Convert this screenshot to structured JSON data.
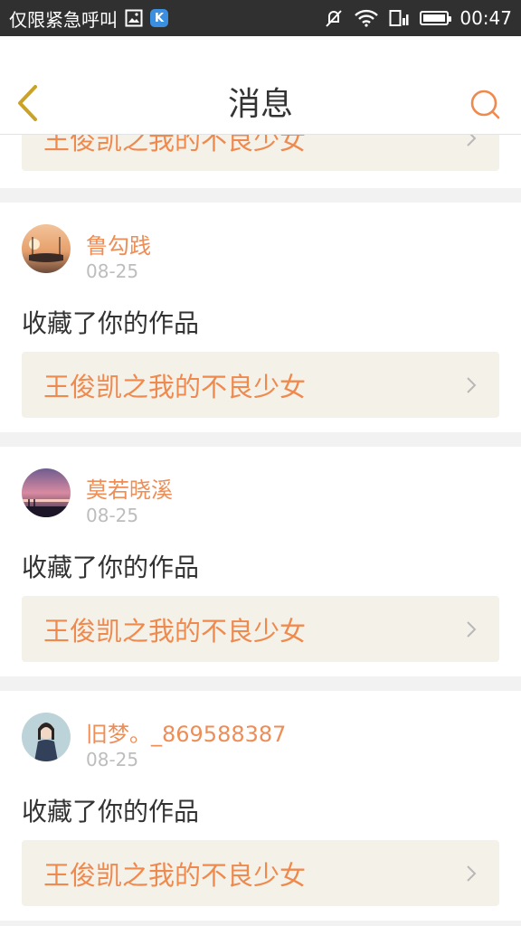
{
  "status_bar": {
    "carrier": "仅限紧急呼叫",
    "time": "00:47",
    "k_badge": "K"
  },
  "header": {
    "title": "消息"
  },
  "partial_card": {
    "work_title": "王俊凯之我的不良少女"
  },
  "messages": [
    {
      "username": "鲁勾践",
      "date": "08-25",
      "action": "收藏了你的作品",
      "work_title": "王俊凯之我的不良少女"
    },
    {
      "username": "莫若晓溪",
      "date": "08-25",
      "action": "收藏了你的作品",
      "work_title": "王俊凯之我的不良少女"
    },
    {
      "username": "旧梦。_869588387",
      "date": "08-25",
      "action": "收藏了你的作品",
      "work_title": "王俊凯之我的不良少女"
    }
  ],
  "colors": {
    "accent": "#ef8a4f",
    "back_icon": "#c9a227",
    "status_bar_bg": "#303030"
  }
}
